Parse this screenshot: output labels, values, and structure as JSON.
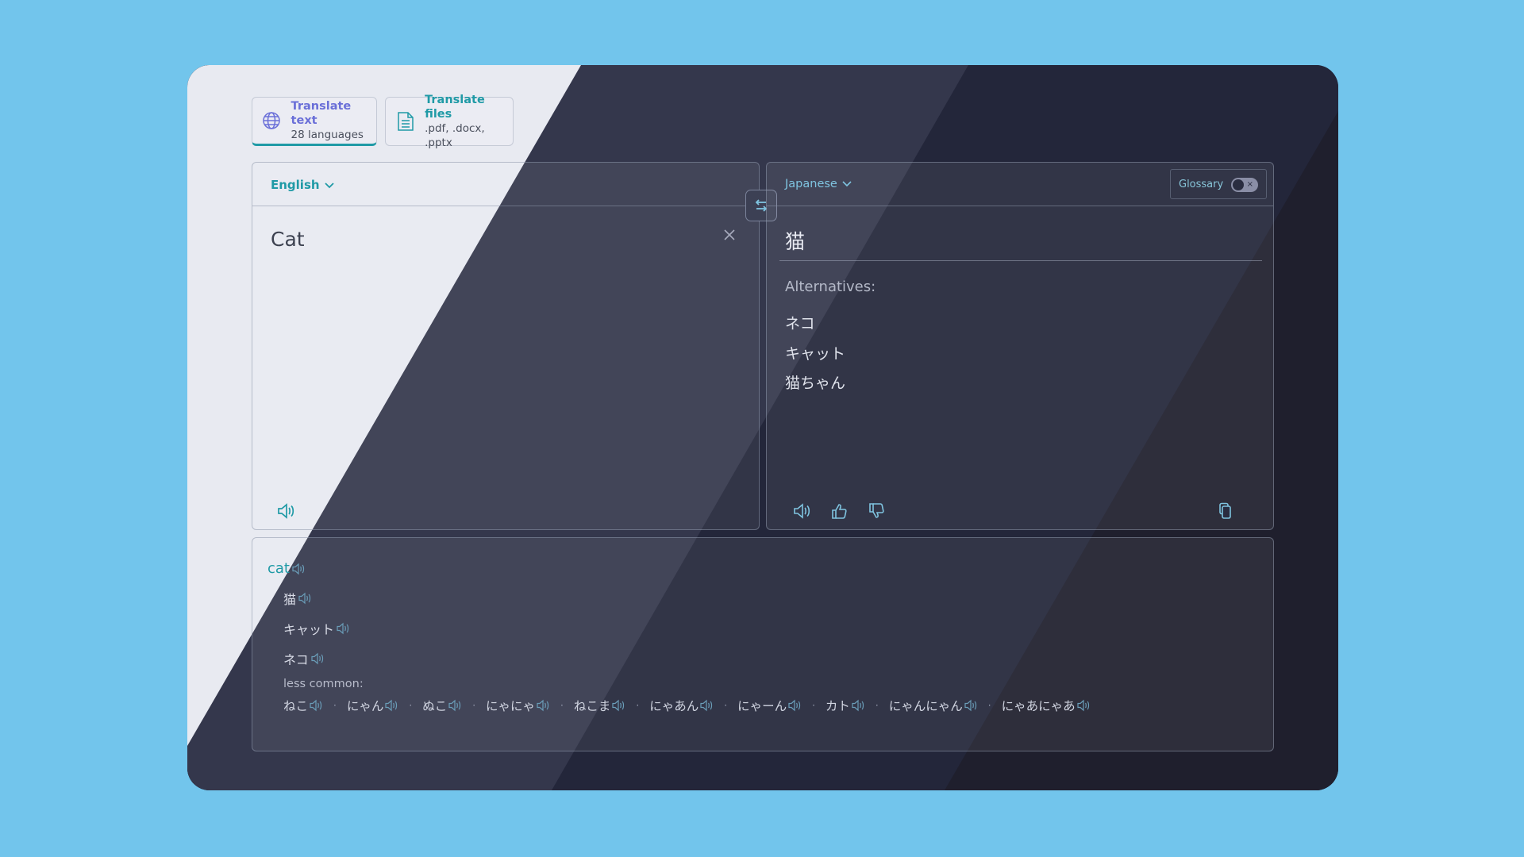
{
  "tabs": [
    {
      "title": "Translate text",
      "subtitle": "28 languages",
      "icon": "globe-icon",
      "active": true
    },
    {
      "title": "Translate files",
      "subtitle": ".pdf, .docx, .pptx",
      "icon": "document-icon",
      "active": false
    }
  ],
  "source": {
    "language": "English",
    "text": "Cat"
  },
  "target": {
    "language": "Japanese",
    "glossary_label": "Glossary",
    "glossary_enabled": false,
    "text": "猫",
    "alternatives_label": "Alternatives:",
    "alternatives": [
      "ネコ",
      "キャット",
      "猫ちゃん"
    ]
  },
  "dictionary": {
    "word": "cat",
    "translations": [
      "猫",
      "キャット",
      "ネコ"
    ],
    "less_common_label": "less common:",
    "less_common": [
      "ねこ",
      "にゃん",
      "ぬこ",
      "にゃにゃ",
      "ねこま",
      "にゃあん",
      "にゃーん",
      "カト",
      "にゃんにゃん",
      "にゃあにゃあ"
    ]
  },
  "colors": {
    "accent_teal": "#1f9aa6",
    "accent_indigo": "#6a6fd8",
    "sky_background": "#72c5ec",
    "dark_surface": "#23263a",
    "light_surface": "#e8eaf1"
  }
}
